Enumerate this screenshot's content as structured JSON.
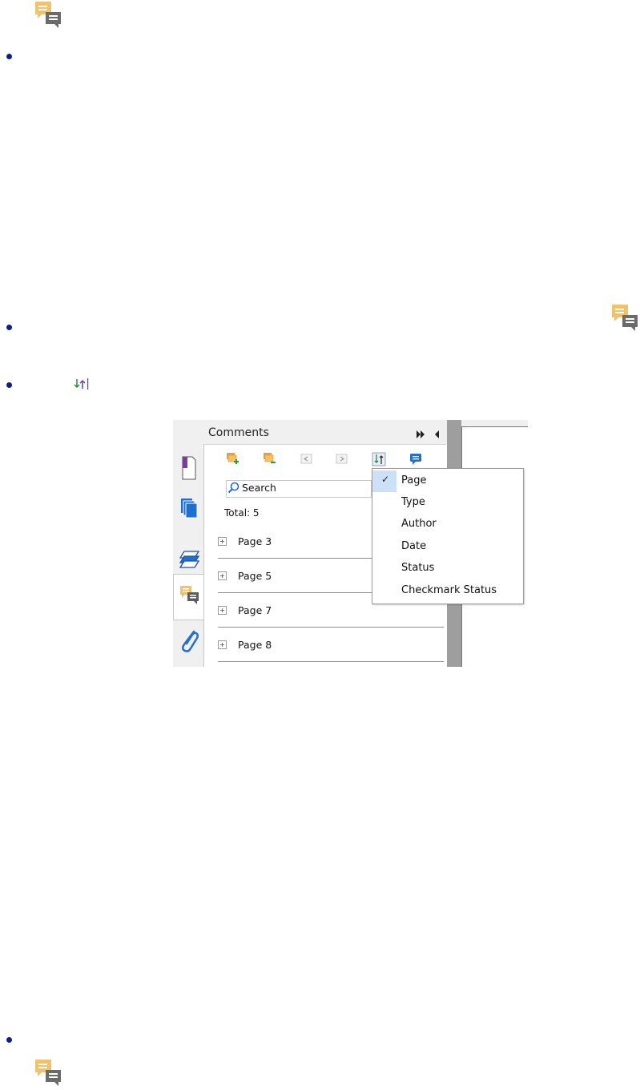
{
  "page": {
    "bullets": 4
  },
  "inline_icons": {
    "sort_glyph": "↓↑|"
  },
  "panel": {
    "title": "Comments",
    "title_controls": "▸▸ ◂",
    "toolbar": [
      "expand-all-icon",
      "collapse-all-icon",
      "previous-icon",
      "next-icon",
      "sort-icon",
      "filter-comments-icon"
    ],
    "search": {
      "placeholder": "Search"
    },
    "total": "Total: 5",
    "rows": [
      {
        "label": "Page 3"
      },
      {
        "label": "Page 5"
      },
      {
        "label": "Page 7"
      },
      {
        "label": "Page 8"
      }
    ],
    "tabs": [
      "bookmarks-icon",
      "pages-icon",
      "layers-icon",
      "comments-icon",
      "attachments-icon"
    ]
  },
  "sort_menu": {
    "items": [
      {
        "label": "Page",
        "checked": true
      },
      {
        "label": "Type",
        "checked": false
      },
      {
        "label": "Author",
        "checked": false
      },
      {
        "label": "Date",
        "checked": false
      },
      {
        "label": "Status",
        "checked": false
      },
      {
        "label": "Checkmark Status",
        "checked": false
      }
    ],
    "check_glyph": "✓"
  },
  "colors": {
    "comment_icon_yellow": "#f2c26b",
    "comment_icon_gray": "#6b6b6b",
    "bullet_blue": "#0a1f8f",
    "menu_highlight": "#cce0f7",
    "accent_blue": "#1f6fd1",
    "orange": "#e8a13a"
  }
}
